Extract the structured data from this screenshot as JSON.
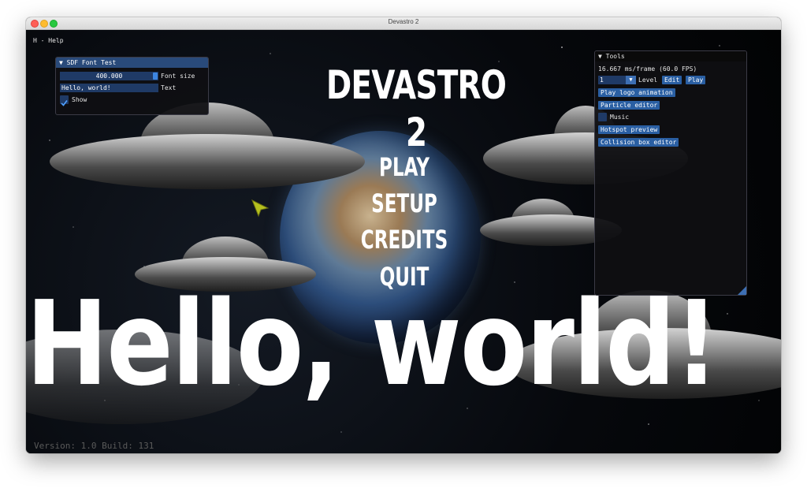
{
  "window": {
    "title": "Devastro 2"
  },
  "overlay": {
    "help_text": "H - Help",
    "version_text": "Version: 1.0 Build: 131"
  },
  "game": {
    "title": "DEVASTRO 2",
    "menu": [
      "PLAY",
      "SETUP",
      "CREDITS",
      "QUIT"
    ],
    "big_text": "Hello, world!"
  },
  "sdf_panel": {
    "title": "SDF Font Test",
    "font_size_value": "400.000",
    "font_size_label": "Font size",
    "text_value": "Hello, world!",
    "text_label": "Text",
    "show_label": "Show",
    "show_checked": true
  },
  "tools_panel": {
    "title": "Tools",
    "fps_text": "16.667 ms/frame (60.0 FPS)",
    "level_value": "1",
    "level_label": "Level",
    "edit_button": "Edit",
    "play_button": "Play",
    "play_logo_button": "Play logo animation",
    "particle_editor_button": "Particle editor",
    "music_label": "Music",
    "music_checked": false,
    "hotspot_preview_button": "Hotspot preview",
    "collision_box_button": "Collision box editor"
  },
  "colors": {
    "imgui_accent": "#3d85e0",
    "imgui_frame": "#1f3a66",
    "imgui_title_active": "#294a7a"
  }
}
